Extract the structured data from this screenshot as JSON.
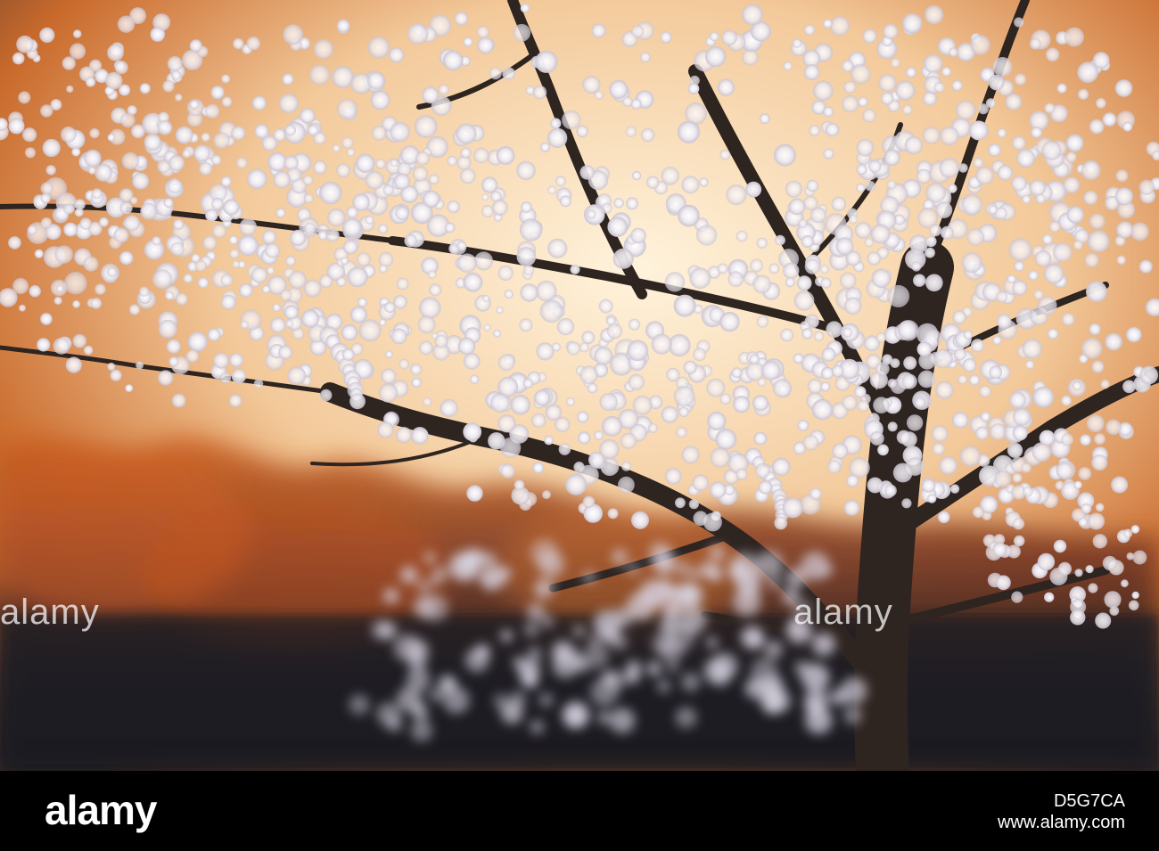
{
  "photo": {
    "colors": {
      "sky_glow": "#ffd9a8",
      "sunset_orange": "#e66a1e",
      "blossom": "#f4f1f3",
      "branch": "#2e2420",
      "dark_ground": "#1c1c24"
    }
  },
  "watermarks": {
    "left": "alamy",
    "middle": "alamy"
  },
  "footer": {
    "logo": "alamy",
    "image_id": "D5G7CA",
    "site": "www.alamy.com"
  }
}
